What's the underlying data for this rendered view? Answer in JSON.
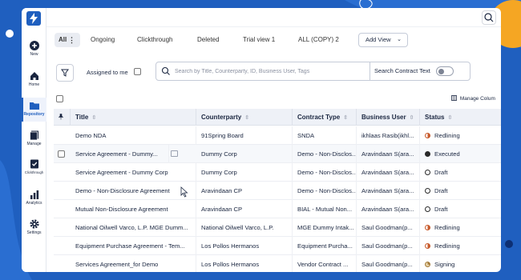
{
  "colors": {
    "brand": "#1f5fbf",
    "accent_orange": "#f5a623",
    "status_redlining": "#c75a2b",
    "status_executed": "#2a2a2a",
    "status_signing": "#a47a3a"
  },
  "sidebar": {
    "logo_icon": "lightning-bolt-icon",
    "items": [
      {
        "label": "New",
        "icon": "plus-circle-icon"
      },
      {
        "label": "Home",
        "icon": "home-icon"
      },
      {
        "label": "Repository",
        "icon": "folder-icon",
        "active": true
      },
      {
        "label": "Manage",
        "icon": "stack-icon"
      },
      {
        "label": "Clickthrough",
        "icon": "checklist-icon"
      },
      {
        "label": "Analytics",
        "icon": "bar-chart-icon"
      },
      {
        "label": "Settings",
        "icon": "gear-icon"
      }
    ]
  },
  "topbar": {
    "search_icon": "search-icon"
  },
  "tabs": {
    "items": [
      "All",
      "Ongoing",
      "Clickthrough",
      "Deleted",
      "Trial view 1",
      "ALL (COPY) 2"
    ],
    "more_glyph": "⋮",
    "add_view_label": "Add View",
    "chevron_glyph": "⌄"
  },
  "filters": {
    "assigned_label": "Assigned to me",
    "search_placeholder": "Search by Title, Counterparty, ID, Business User, Tags",
    "search_contract_text_label": "Search Contract Text"
  },
  "table": {
    "manage_columns_label": "Manage Colum",
    "headers": [
      "Title",
      "Counterparty",
      "Contract Type",
      "Business User",
      "Status"
    ],
    "rows": [
      {
        "title": "Demo NDA",
        "counterparty": "91Spring Board",
        "contract_type": "SNDA",
        "business_user": "ikhlaas Rasib(ikhl...",
        "status": "Redlining"
      },
      {
        "title": "Service Agreement - Dummy...",
        "counterparty": "Dummy Corp",
        "contract_type": "Demo - Non-Disclos...",
        "business_user": "Aravindaan S(ara...",
        "status": "Executed"
      },
      {
        "title": "Service Agreement - Dummy Corp",
        "counterparty": "Dummy Corp",
        "contract_type": "Demo - Non-Disclos...",
        "business_user": "Aravindaan S(ara...",
        "status": "Draft"
      },
      {
        "title": "Demo - Non-Disclosure Agreement",
        "counterparty": "Aravindaan CP",
        "contract_type": "Demo - Non-Disclos...",
        "business_user": "Aravindaan S(ara...",
        "status": "Draft"
      },
      {
        "title": "Mutual Non-Disclosure Agreement",
        "counterparty": "Aravindaan CP",
        "contract_type": "BIAL - Mutual Non...",
        "business_user": "Aravindaan S(ara...",
        "status": "Draft"
      },
      {
        "title": "National Oilwell Varco, L.P. MGE Dumm...",
        "counterparty": "National Oilwell Varco, L.P.",
        "contract_type": "MGE Dummy Intak...",
        "business_user": "Saul Goodman(p...",
        "status": "Redlining"
      },
      {
        "title": "Equipment Purchase Agreement - Tem...",
        "counterparty": "Los Pollos Hermanos",
        "contract_type": "Equipment Purcha...",
        "business_user": "Saul Goodman(p...",
        "status": "Redlining"
      },
      {
        "title": "Services Agreement_for Demo",
        "counterparty": "Los Pollos Hermanos",
        "contract_type": "Vendor Contract ...",
        "business_user": "Saul Goodman(p...",
        "status": "Signing"
      }
    ]
  }
}
